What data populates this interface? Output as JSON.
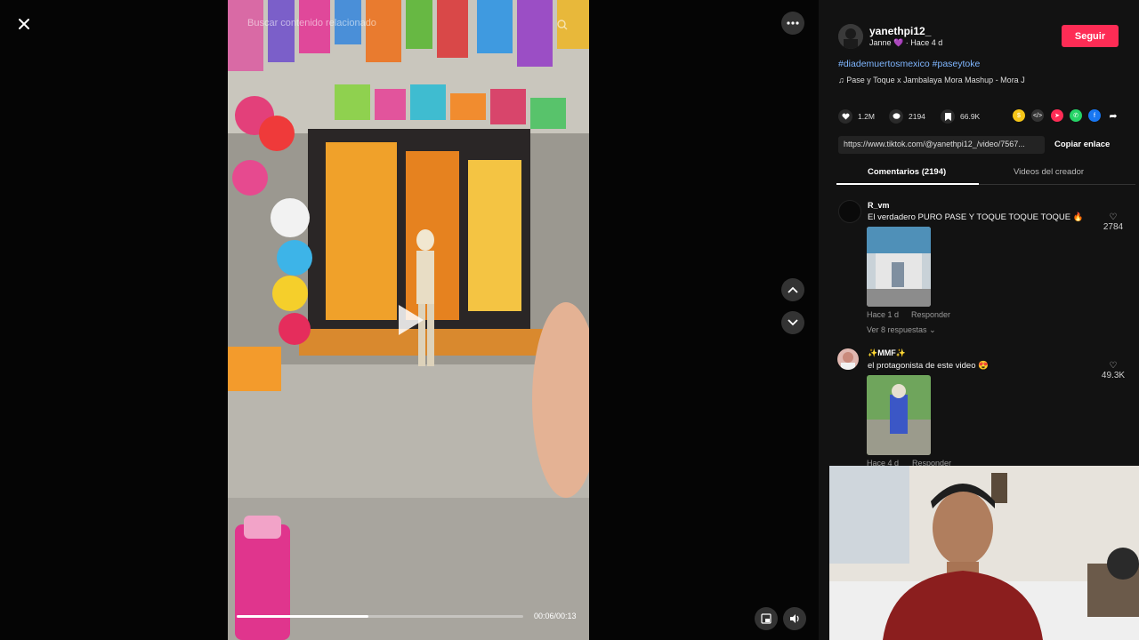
{
  "player": {
    "search_placeholder": "Buscar contenido relacionado",
    "time": "00:06/00:13",
    "progress_fraction": 0.46
  },
  "post": {
    "username": "yanethpi12_",
    "display_name": "Janne 💜",
    "time_ago": "Hace 4 d",
    "follow_label": "Seguir",
    "hashtags": "#diademuertosmexico #paseytoke",
    "music": "Pase y Toque x Jambalaya Mora Mashup - Mora J",
    "likes": "1.2M",
    "comments_count": "2194",
    "saves": "66.9K",
    "link": "https://www.tiktok.com/@yanethpi12_/video/7567...",
    "copy_label": "Copiar enlace"
  },
  "tabs": {
    "comments": "Comentarios (2194)",
    "creator_videos": "Videos del creador"
  },
  "comments": [
    {
      "user": "R_vm",
      "text": "El verdadero PURO PASE Y TOQUE TOQUE TOQUE 🔥",
      "likes": "2784",
      "time": "Hace 1 d",
      "reply_label": "Responder",
      "replies": "Ver 8 respuestas"
    },
    {
      "user": "✨MMF✨",
      "text": "el protagonista de este video 😍",
      "likes": "49.3K",
      "time": "Hace 4 d",
      "reply_label": "Responder"
    }
  ],
  "colors": {
    "accent": "#fe2c55",
    "hashtag": "#7fb6ff",
    "panel_bg": "#121212"
  },
  "icons": {
    "close": "close-icon",
    "more": "more-icon",
    "play": "play-icon",
    "pip": "pip-icon",
    "volume": "volume-icon"
  }
}
